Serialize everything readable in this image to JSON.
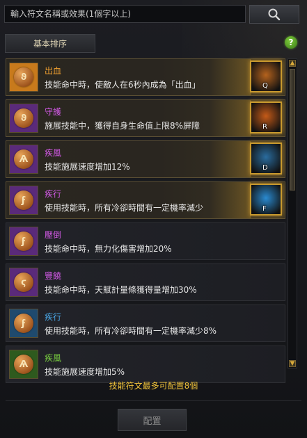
{
  "search": {
    "placeholder": "輸入符文名稱或效果(1個字以上)"
  },
  "toolbar": {
    "sort_label": "基本排序",
    "help_label": "?"
  },
  "runes": [
    {
      "name": "出血",
      "name_color": "#f0a030",
      "desc": "技能命中時，使敵人在6秒內成為「出血」",
      "rune_glyph": "ϑ",
      "icon_bg": "#c87a1c",
      "skill_key": "Q",
      "skill_icon": "bleed-skill-icon",
      "skill_color": "#b4621d"
    },
    {
      "name": "守護",
      "name_color": "#d45ae8",
      "desc": "施展技能中，獲得自身生命值上限8%屏障",
      "rune_glyph": "ϑ",
      "icon_bg": "#5a2a7a",
      "skill_key": "R",
      "skill_icon": "guard-skill-icon",
      "skill_color": "#c45a18"
    },
    {
      "name": "疾風",
      "name_color": "#d45ae8",
      "desc": "技能施展速度增加12%",
      "rune_glyph": "Ѧ",
      "icon_bg": "#5a2a7a",
      "skill_key": "D",
      "skill_icon": "gale-skill-icon",
      "skill_color": "#2a6c9e"
    },
    {
      "name": "疾行",
      "name_color": "#d45ae8",
      "desc": "使用技能時，所有冷卻時間有一定機率減少",
      "rune_glyph": "ϝ",
      "icon_bg": "#5a2a7a",
      "skill_key": "F",
      "skill_icon": "haste-skill-icon",
      "skill_color": "#2a8ad0"
    },
    {
      "name": "壓倒",
      "name_color": "#d45ae8",
      "desc": "技能命中時，無力化傷害增加20%",
      "rune_glyph": "ϝ",
      "icon_bg": "#5a2a7a"
    },
    {
      "name": "豐饒",
      "name_color": "#d45ae8",
      "desc": "技能命中時，天賦計量條獲得量增加30%",
      "rune_glyph": "ϛ",
      "icon_bg": "#5a2a7a"
    },
    {
      "name": "疾行",
      "name_color": "#4aa8e8",
      "desc": "使用技能時，所有冷卻時間有一定機率減少8%",
      "rune_glyph": "ϝ",
      "icon_bg": "#1f4a6e"
    },
    {
      "name": "疾風",
      "name_color": "#7ad040",
      "desc": "技能施展速度增加5%",
      "rune_glyph": "Ѧ",
      "icon_bg": "#2e5a1e"
    }
  ],
  "footer": {
    "note": "技能符文最多可配置8個",
    "config_label": "配置"
  },
  "colors": {
    "accent_gold": "#f0c23a",
    "selected_border": "#c99a2e"
  }
}
